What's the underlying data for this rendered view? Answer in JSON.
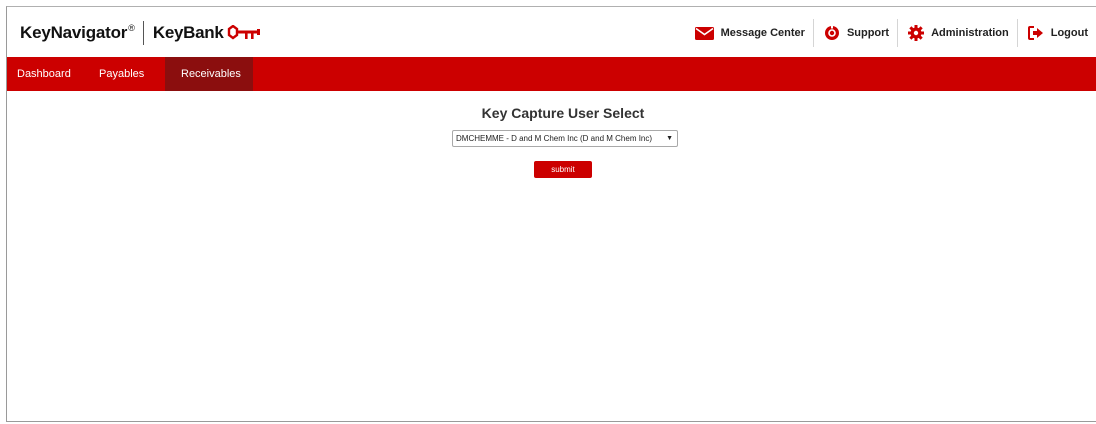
{
  "header": {
    "brand_keynavigator": "KeyNavigator",
    "brand_registered": "®",
    "brand_keybank": "KeyBank",
    "actions": [
      {
        "label": "Message Center",
        "icon": "envelope-icon"
      },
      {
        "label": "Support",
        "icon": "lifebuoy-icon"
      },
      {
        "label": "Administration",
        "icon": "gear-icon"
      },
      {
        "label": "Logout",
        "icon": "logout-icon"
      }
    ]
  },
  "nav": {
    "tabs": [
      {
        "label": "Dashboard"
      },
      {
        "label": "Payables"
      },
      {
        "label": "Receivables",
        "active": true
      }
    ]
  },
  "main": {
    "title": "Key Capture User Select",
    "select_value": "DMCHEMME - D and M Chem Inc (D and M Chem Inc)",
    "submit_label": "submit"
  },
  "colors": {
    "brand_red": "#cc0000",
    "active_tab": "#8b0e0e"
  }
}
